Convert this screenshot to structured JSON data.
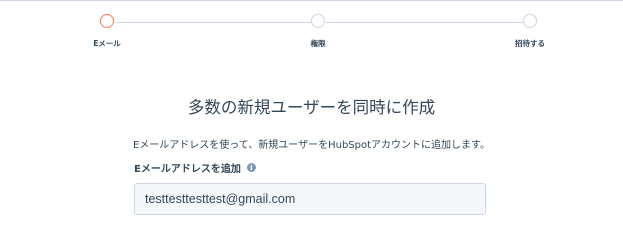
{
  "stepper": {
    "steps": [
      {
        "label": "Eメール",
        "state": "active"
      },
      {
        "label": "権限",
        "state": "upcoming"
      },
      {
        "label": "招待する",
        "state": "upcoming"
      }
    ],
    "active_color": "#ff7a59",
    "inactive_color": "#cbd6e2"
  },
  "main": {
    "title": "多数の新規ユーザーを同時に作成",
    "description": "Eメールアドレスを使って、新規ユーザーをHubSpotアカウントに追加します。",
    "email_field": {
      "label": "Eメールアドレスを追加",
      "info_icon": "info-icon",
      "value": "testtesttesttest@gmail.com"
    }
  }
}
